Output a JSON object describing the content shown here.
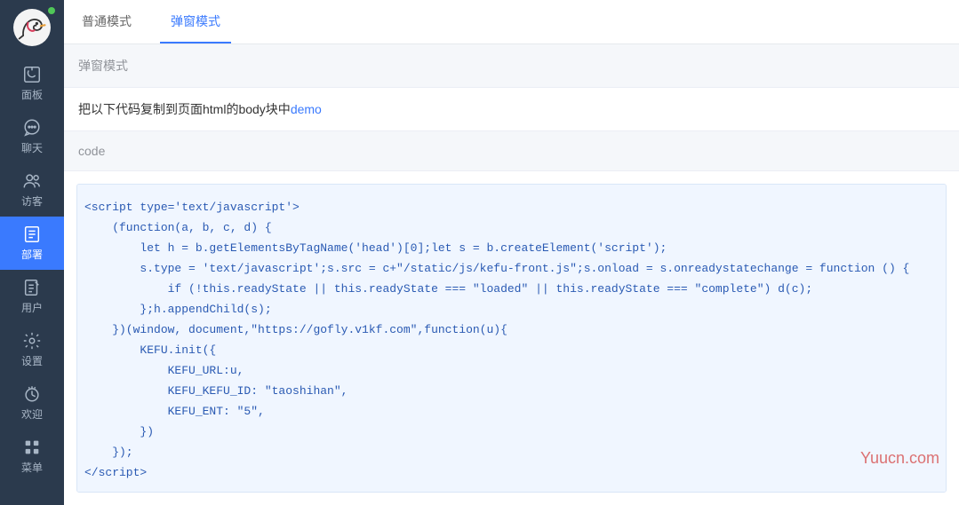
{
  "sidebar": {
    "items": [
      {
        "label": "面板",
        "icon": "panel-icon"
      },
      {
        "label": "聊天",
        "icon": "chat-icon"
      },
      {
        "label": "访客",
        "icon": "visitor-icon"
      },
      {
        "label": "部署",
        "icon": "deploy-icon",
        "active": true
      },
      {
        "label": "用户",
        "icon": "user-icon"
      },
      {
        "label": "设置",
        "icon": "settings-icon"
      },
      {
        "label": "欢迎",
        "icon": "welcome-icon"
      },
      {
        "label": "菜单",
        "icon": "menu-icon"
      }
    ]
  },
  "tabs": [
    {
      "label": "普通模式",
      "active": false
    },
    {
      "label": "弹窗模式",
      "active": true
    }
  ],
  "section_title": "弹窗模式",
  "instruction_text": "把以下代码复制到页面html的body块中",
  "instruction_link": "demo",
  "code_header": "code",
  "code_content": "<script type='text/javascript'>\n    (function(a, b, c, d) {\n        let h = b.getElementsByTagName('head')[0];let s = b.createElement('script');\n        s.type = 'text/javascript';s.src = c+\"/static/js/kefu-front.js\";s.onload = s.onreadystatechange = function () {\n            if (!this.readyState || this.readyState === \"loaded\" || this.readyState === \"complete\") d(c);\n        };h.appendChild(s);\n    })(window, document,\"https://gofly.v1kf.com\",function(u){\n        KEFU.init({\n            KEFU_URL:u,\n            KEFU_KEFU_ID: \"taoshihan\",\n            KEFU_ENT: \"5\",\n        })\n    });\n</script>",
  "watermark": "Yuucn.com"
}
